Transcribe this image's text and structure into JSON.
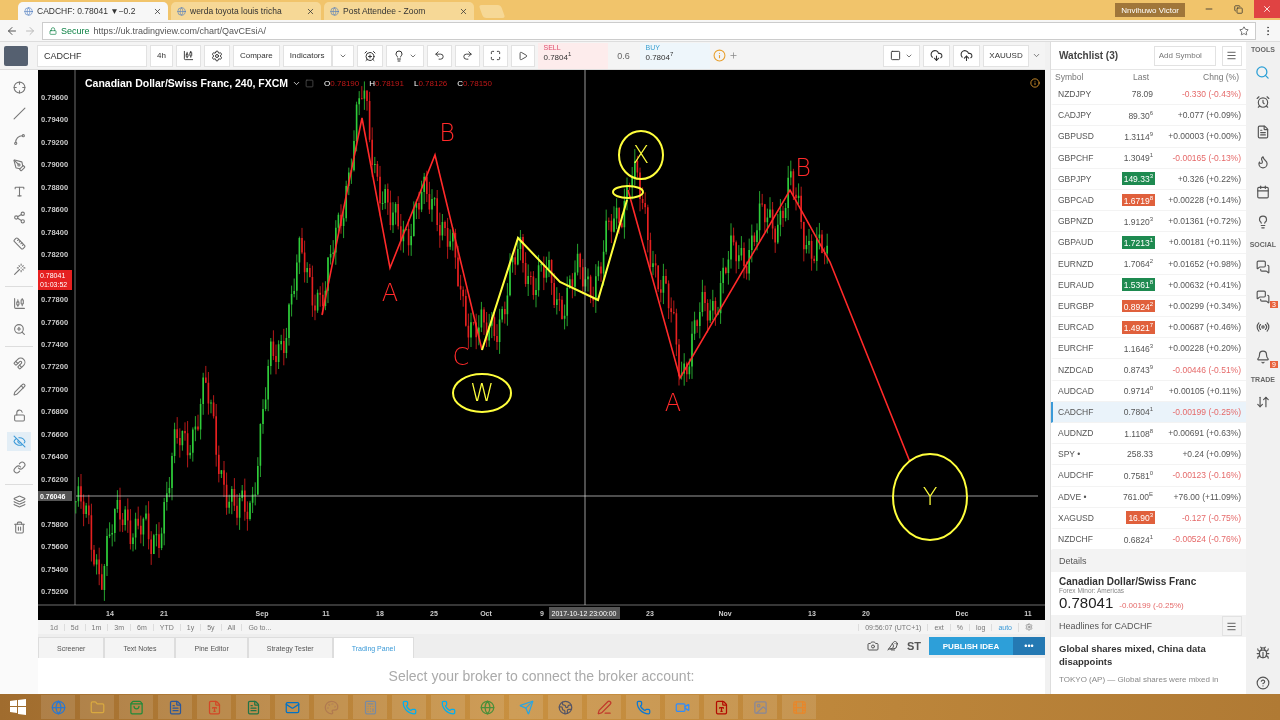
{
  "browser": {
    "tabs": [
      {
        "title": "CADCHF: 0.78041 ▼−0.2",
        "selected": true
      },
      {
        "title": "werda toyota louis tricha",
        "selected": false
      },
      {
        "title": "Post Attendee - Zoom",
        "selected": false
      }
    ],
    "profile": "Nnvihuwo Victor",
    "security": "Secure",
    "url": "https://uk.tradingview.com/chart/QavCEsiA/"
  },
  "toolbar": {
    "symbol": "CADCHF",
    "interval": "4h",
    "compare": "Compare",
    "indicators": "Indicators",
    "sell_label": "SELL",
    "sell_price": "0.7804$^{1}$",
    "spread": "0.6",
    "buy_label": "BUY",
    "buy_price": "0.7804$^{7}$",
    "symbol_box": "XAUUSD"
  },
  "drawing_tools": {
    "hide_drawings": {
      "on": true
    }
  },
  "chart": {
    "title": "Canadian Dollar/Swiss Franc, 240, FXCM",
    "ohlc": [
      {
        "label": "O",
        "value": "0.78190"
      },
      {
        "label": "H",
        "value": "0.78191"
      },
      {
        "label": "L",
        "value": "0.78126"
      },
      {
        "label": "C",
        "value": "0.78150"
      }
    ],
    "price_ticks": [
      "0.79600",
      "0.79400",
      "0.79200",
      "0.79000",
      "0.78800",
      "0.78600",
      "0.78400",
      "0.78200",
      "0.77800",
      "0.77600",
      "0.77400",
      "0.77200",
      "0.77000",
      "0.76800",
      "0.76600",
      "0.76400",
      "0.76200",
      "0.75800",
      "0.75600",
      "0.75400",
      "0.75200"
    ],
    "last_price": "0.78041",
    "countdown": "01:03:52",
    "crosshair_price": "0.76046",
    "time_ticks": [
      "14",
      "21",
      "Sep",
      "11",
      "18",
      "25",
      "Oct",
      "9",
      "23",
      "Nov",
      "13",
      "20",
      "Dec",
      "11"
    ],
    "crosshair_time": "2017-10-12 23:00:00",
    "annotations": [
      {
        "kind": "plain",
        "text": "B",
        "color": "#ff2a2a"
      },
      {
        "kind": "plain",
        "text": "A",
        "color": "#ff2a2a"
      },
      {
        "kind": "plain",
        "text": "C",
        "color": "#ff2a2a"
      },
      {
        "kind": "circled",
        "text": "W",
        "color": "#ffff3c"
      },
      {
        "kind": "circled",
        "text": "X",
        "color": "#ffff3c"
      },
      {
        "kind": "plain",
        "text": "A",
        "color": "#ff2a2a"
      },
      {
        "kind": "plain",
        "text": "B",
        "color": "#ff2a2a"
      },
      {
        "kind": "circled",
        "text": "Y",
        "color": "#ffff3c"
      }
    ]
  },
  "range_bar": {
    "ranges": [
      "1d",
      "5d",
      "1m",
      "3m",
      "6m",
      "YTD",
      "1y",
      "5y",
      "All"
    ],
    "goto": "Go to...",
    "clock": "09:56:07 (UTC+1)",
    "options": [
      {
        "label": "ext",
        "selected": false
      },
      {
        "label": "%",
        "selected": false
      },
      {
        "label": "log",
        "selected": false
      },
      {
        "label": "auto",
        "selected": true
      }
    ]
  },
  "bottom_panel": {
    "tabs": [
      {
        "label": "Screener",
        "selected": false
      },
      {
        "label": "Text Notes",
        "selected": false
      },
      {
        "label": "Pine Editor",
        "selected": false
      },
      {
        "label": "Strategy Tester",
        "selected": false
      },
      {
        "label": "Trading Panel",
        "selected": true
      }
    ],
    "st": "ST",
    "publish": "PUBLISH IDEA",
    "more": "•••",
    "message": "Select your broker to connect the broker account:"
  },
  "watchlist": {
    "title": "Watchlist (3)",
    "add_placeholder": "Add Symbol",
    "columns": [
      "Symbol",
      "Last",
      "Chng (%)"
    ],
    "rows": [
      {
        "symbol": "NZDJPY",
        "last": "78.09",
        "change": "-0.330 (-0.43%)",
        "falling": true,
        "selected": false
      },
      {
        "symbol": "CADJPY",
        "last": "89.30$^{6}$",
        "change": "+0.077 (+0.09%)",
        "falling": false,
        "selected": false
      },
      {
        "symbol": "GBPUSD",
        "last": "1.3114$^{9}$",
        "change": "+0.00003 (+0.00%)",
        "falling": false,
        "selected": false
      },
      {
        "symbol": "GBPCHF",
        "last": "1.3049$^{1}$",
        "change": "-0.00165 (-0.13%)",
        "falling": true,
        "selected": false
      },
      {
        "symbol": "GBPJPY",
        "last": "149.33$^{3}$",
        "change": "+0.326 (+0.22%)",
        "falling": false,
        "color": "#1e8a50",
        "selected": false
      },
      {
        "symbol": "GBPCAD",
        "last": "1.6719$^{8}$",
        "change": "+0.00228 (+0.14%)",
        "falling": false,
        "color": "#e0603c",
        "selected": false
      },
      {
        "symbol": "GBPNZD",
        "last": "1.9120$^{3}$",
        "change": "+0.01361 (+0.72%)",
        "falling": false,
        "selected": false
      },
      {
        "symbol": "GBPAUD",
        "last": "1.7213$^{1}$",
        "change": "+0.00181 (+0.11%)",
        "falling": false,
        "color": "#1e8a50",
        "selected": false
      },
      {
        "symbol": "EURNZD",
        "last": "1.7064$^{2}$",
        "change": "+0.01652 (+0.98%)",
        "falling": false,
        "selected": false
      },
      {
        "symbol": "EURAUD",
        "last": "1.5361$^{8}$",
        "change": "+0.00632 (+0.41%)",
        "falling": false,
        "color": "#1e8a50",
        "selected": false
      },
      {
        "symbol": "EURGBP",
        "last": "0.8924$^{2}$",
        "change": "+0.00299 (+0.34%)",
        "falling": false,
        "color": "#e0603c",
        "selected": false
      },
      {
        "symbol": "EURCAD",
        "last": "1.4921$^{7}$",
        "change": "+0.00687 (+0.46%)",
        "falling": false,
        "color": "#e0603c",
        "selected": false
      },
      {
        "symbol": "EURCHF",
        "last": "1.1646$^{3}$",
        "change": "+0.00228 (+0.20%)",
        "falling": false,
        "selected": false
      },
      {
        "symbol": "NZDCAD",
        "last": "0.8743$^{9}$",
        "change": "-0.00446 (-0.51%)",
        "falling": true,
        "selected": false
      },
      {
        "symbol": "AUDCAD",
        "last": "0.9714$^{0}$",
        "change": "+0.00105 (+0.11%)",
        "falling": false,
        "selected": false
      },
      {
        "symbol": "CADCHF",
        "last": "0.7804$^{1}$",
        "change": "-0.00199 (-0.25%)",
        "falling": true,
        "selected": true
      },
      {
        "symbol": "AUDNZD",
        "last": "1.1108$^{8}$",
        "change": "+0.00691 (+0.63%)",
        "falling": false,
        "selected": false
      },
      {
        "symbol": "SPY •",
        "last": "258.33",
        "change": "+0.24 (+0.09%)",
        "falling": false,
        "selected": false
      },
      {
        "symbol": "AUDCHF",
        "last": "0.7581$^{0}$",
        "change": "-0.00123 (-0.16%)",
        "falling": true,
        "selected": false
      },
      {
        "symbol": "ADVE •",
        "last": "761.00$^{E}$",
        "change": "+76.00 (+11.09%)",
        "falling": false,
        "selected": false
      },
      {
        "symbol": "XAGUSD",
        "last": "16.90$^{3}$",
        "change": "-0.127 (-0.75%)",
        "falling": true,
        "color": "#e0603c",
        "selected": false
      },
      {
        "symbol": "NZDCHF",
        "last": "0.6824$^{1}$",
        "change": "-0.00524 (-0.76%)",
        "falling": true,
        "selected": false
      }
    ]
  },
  "details": {
    "heading": "Details",
    "name": "Canadian Dollar/Swiss Franc",
    "category": "Forex Minor: Americas",
    "price": "0.78041",
    "change": "-0.00199 (-0.25%)"
  },
  "headlines": {
    "heading": "Headlines for CADCHF",
    "title": "Global shares mixed, China data disappoints",
    "snippet": "TOKYO (AP) — Global shares were mixed in"
  },
  "side_strip": {
    "tools_label": "TOOLS",
    "social_label": "SOCIAL",
    "trade_label": "TRADE",
    "chat_badge": "3",
    "alert_badge": "9"
  }
}
